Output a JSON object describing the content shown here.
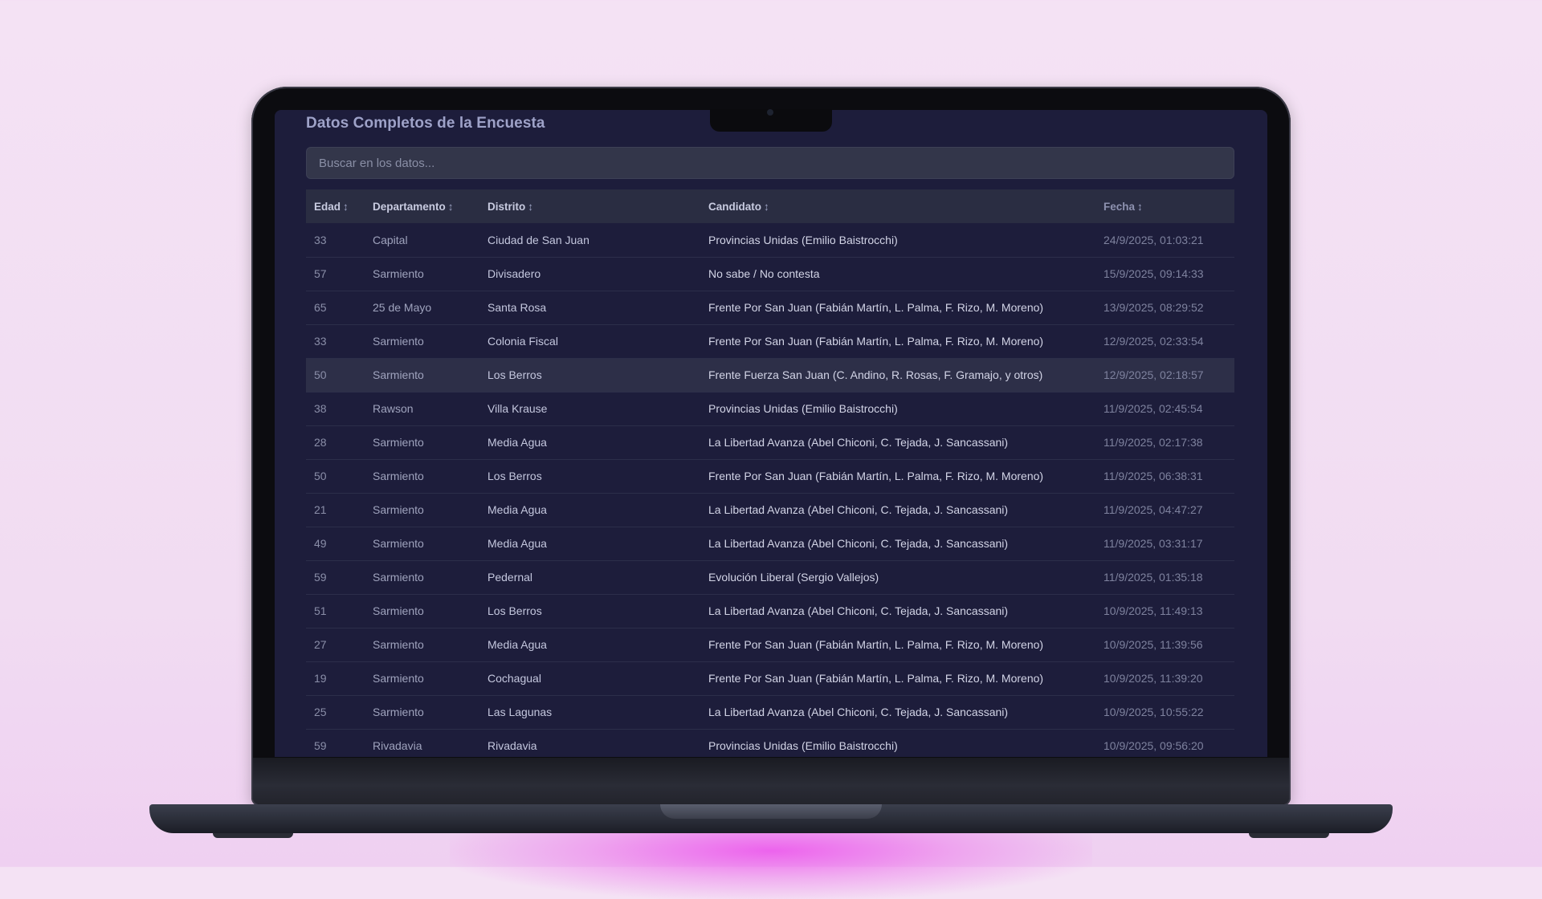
{
  "page": {
    "title": "Datos Completos de la Encuesta",
    "search_placeholder": "Buscar en los datos..."
  },
  "table": {
    "columns": [
      "Edad",
      "Departamento",
      "Distrito",
      "Candidato",
      "Fecha"
    ],
    "sort_indicator": "↕",
    "rows": [
      {
        "edad": "33",
        "departamento": "Capital",
        "distrito": "Ciudad de San Juan",
        "candidato": "Provincias Unidas (Emilio Baistrocchi)",
        "fecha": "24/9/2025, 01:03:21"
      },
      {
        "edad": "57",
        "departamento": "Sarmiento",
        "distrito": "Divisadero",
        "candidato": "No sabe / No contesta",
        "fecha": "15/9/2025, 09:14:33"
      },
      {
        "edad": "65",
        "departamento": "25 de Mayo",
        "distrito": "Santa Rosa",
        "candidato": "Frente Por San Juan (Fabián Martín, L. Palma, F. Rizo, M. Moreno)",
        "fecha": "13/9/2025, 08:29:52"
      },
      {
        "edad": "33",
        "departamento": "Sarmiento",
        "distrito": "Colonia Fiscal",
        "candidato": "Frente Por San Juan (Fabián Martín, L. Palma, F. Rizo, M. Moreno)",
        "fecha": "12/9/2025, 02:33:54"
      },
      {
        "edad": "50",
        "departamento": "Sarmiento",
        "distrito": "Los Berros",
        "candidato": "Frente Fuerza San Juan (C. Andino, R. Rosas, F. Gramajo, y otros)",
        "fecha": "12/9/2025, 02:18:57"
      },
      {
        "edad": "38",
        "departamento": "Rawson",
        "distrito": "Villa Krause",
        "candidato": "Provincias Unidas (Emilio Baistrocchi)",
        "fecha": "11/9/2025, 02:45:54"
      },
      {
        "edad": "28",
        "departamento": "Sarmiento",
        "distrito": "Media Agua",
        "candidato": "La Libertad Avanza (Abel Chiconi, C. Tejada, J. Sancassani)",
        "fecha": "11/9/2025, 02:17:38"
      },
      {
        "edad": "50",
        "departamento": "Sarmiento",
        "distrito": "Los Berros",
        "candidato": "Frente Por San Juan (Fabián Martín, L. Palma, F. Rizo, M. Moreno)",
        "fecha": "11/9/2025, 06:38:31"
      },
      {
        "edad": "21",
        "departamento": "Sarmiento",
        "distrito": "Media Agua",
        "candidato": "La Libertad Avanza (Abel Chiconi, C. Tejada, J. Sancassani)",
        "fecha": "11/9/2025, 04:47:27"
      },
      {
        "edad": "49",
        "departamento": "Sarmiento",
        "distrito": "Media Agua",
        "candidato": "La Libertad Avanza (Abel Chiconi, C. Tejada, J. Sancassani)",
        "fecha": "11/9/2025, 03:31:17"
      },
      {
        "edad": "59",
        "departamento": "Sarmiento",
        "distrito": "Pedernal",
        "candidato": "Evolución Liberal (Sergio Vallejos)",
        "fecha": "11/9/2025, 01:35:18"
      },
      {
        "edad": "51",
        "departamento": "Sarmiento",
        "distrito": "Los Berros",
        "candidato": "La Libertad Avanza (Abel Chiconi, C. Tejada, J. Sancassani)",
        "fecha": "10/9/2025, 11:49:13"
      },
      {
        "edad": "27",
        "departamento": "Sarmiento",
        "distrito": "Media Agua",
        "candidato": "Frente Por San Juan (Fabián Martín, L. Palma, F. Rizo, M. Moreno)",
        "fecha": "10/9/2025, 11:39:56"
      },
      {
        "edad": "19",
        "departamento": "Sarmiento",
        "distrito": "Cochagual",
        "candidato": "Frente Por San Juan (Fabián Martín, L. Palma, F. Rizo, M. Moreno)",
        "fecha": "10/9/2025, 11:39:20"
      },
      {
        "edad": "25",
        "departamento": "Sarmiento",
        "distrito": "Las Lagunas",
        "candidato": "La Libertad Avanza (Abel Chiconi, C. Tejada, J. Sancassani)",
        "fecha": "10/9/2025, 10:55:22"
      },
      {
        "edad": "59",
        "departamento": "Rivadavia",
        "distrito": "Rivadavia",
        "candidato": "Provincias Unidas (Emilio Baistrocchi)",
        "fecha": "10/9/2025, 09:56:20"
      }
    ]
  }
}
